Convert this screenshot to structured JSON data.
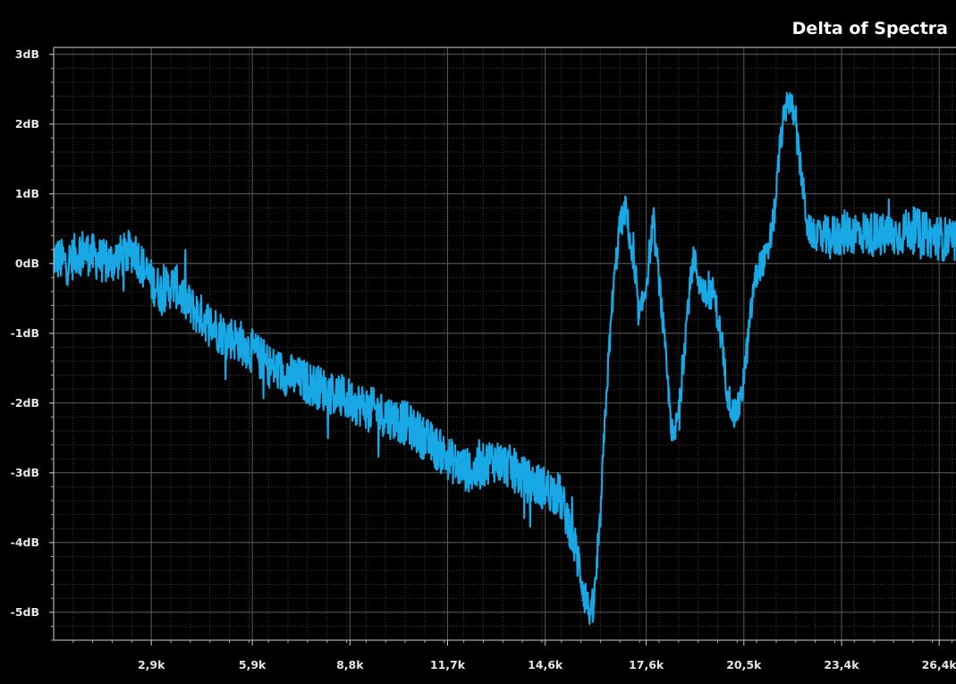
{
  "chart_data": {
    "type": "line",
    "title": "Delta of Spectra",
    "xlabel": "",
    "ylabel": "",
    "xlim": [
      0,
      26800
    ],
    "ylim": [
      -5.4,
      3.1
    ],
    "grid": true,
    "y_ticks": [
      {
        "value": 3,
        "label": "3dB"
      },
      {
        "value": 2,
        "label": "2dB"
      },
      {
        "value": 1,
        "label": "1dB"
      },
      {
        "value": 0,
        "label": "0dB"
      },
      {
        "value": -1,
        "label": "-1dB"
      },
      {
        "value": -2,
        "label": "-2dB"
      },
      {
        "value": -3,
        "label": "-3dB"
      },
      {
        "value": -4,
        "label": "-4dB"
      },
      {
        "value": -5,
        "label": "-5dB"
      }
    ],
    "x_ticks": [
      {
        "value": 2900,
        "label": "2,9k"
      },
      {
        "value": 5900,
        "label": "5,9k"
      },
      {
        "value": 8800,
        "label": "8,8k"
      },
      {
        "value": 11700,
        "label": "11,7k"
      },
      {
        "value": 14600,
        "label": "14,6k"
      },
      {
        "value": 17600,
        "label": "17,6k"
      },
      {
        "value": 20500,
        "label": "20,5k"
      },
      {
        "value": 23400,
        "label": "23,4k"
      },
      {
        "value": 26300,
        "label": "26,4k"
      }
    ],
    "series": [
      {
        "color": "#19a8e6",
        "x": [
          0,
          400,
          800,
          1200,
          1600,
          2000,
          2400,
          2800,
          3200,
          3600,
          4000,
          4500,
          5000,
          5500,
          6000,
          6500,
          7000,
          7500,
          8000,
          8500,
          9000,
          9500,
          10000,
          10500,
          11000,
          11500,
          12000,
          12500,
          13000,
          13500,
          14000,
          14500,
          15000,
          15300,
          15600,
          15800,
          16000,
          16200,
          16400,
          16600,
          16800,
          17000,
          17200,
          17400,
          17600,
          17800,
          18000,
          18200,
          18400,
          18600,
          18800,
          19000,
          19200,
          19400,
          19600,
          19800,
          20000,
          20200,
          20400,
          20600,
          20800,
          21000,
          21200,
          21400,
          21600,
          21800,
          22000,
          22200,
          22400,
          22600,
          22800,
          23000,
          23500,
          24000,
          24500,
          25000,
          25500,
          26000,
          26500,
          26800
        ],
        "values": [
          0.1,
          0.0,
          0.2,
          0.1,
          0.0,
          0.1,
          0.2,
          -0.2,
          -0.4,
          -0.3,
          -0.6,
          -0.8,
          -1.0,
          -1.1,
          -1.3,
          -1.5,
          -1.6,
          -1.7,
          -1.8,
          -1.9,
          -2.0,
          -2.1,
          -2.2,
          -2.3,
          -2.5,
          -2.7,
          -2.9,
          -3.0,
          -2.8,
          -2.9,
          -3.1,
          -3.2,
          -3.3,
          -3.7,
          -4.3,
          -4.8,
          -5.1,
          -4.0,
          -2.0,
          -0.5,
          0.5,
          0.8,
          0.0,
          -0.8,
          -0.3,
          0.6,
          -0.3,
          -1.5,
          -2.6,
          -2.0,
          -0.8,
          0.1,
          -0.3,
          -0.5,
          -0.4,
          -1.0,
          -1.8,
          -2.2,
          -2.0,
          -1.2,
          -0.3,
          0.0,
          0.1,
          0.7,
          1.8,
          2.4,
          2.1,
          1.3,
          0.5,
          0.4,
          0.4,
          0.35,
          0.45,
          0.45,
          0.4,
          0.4,
          0.5,
          0.4,
          0.35,
          0.3
        ]
      }
    ]
  }
}
